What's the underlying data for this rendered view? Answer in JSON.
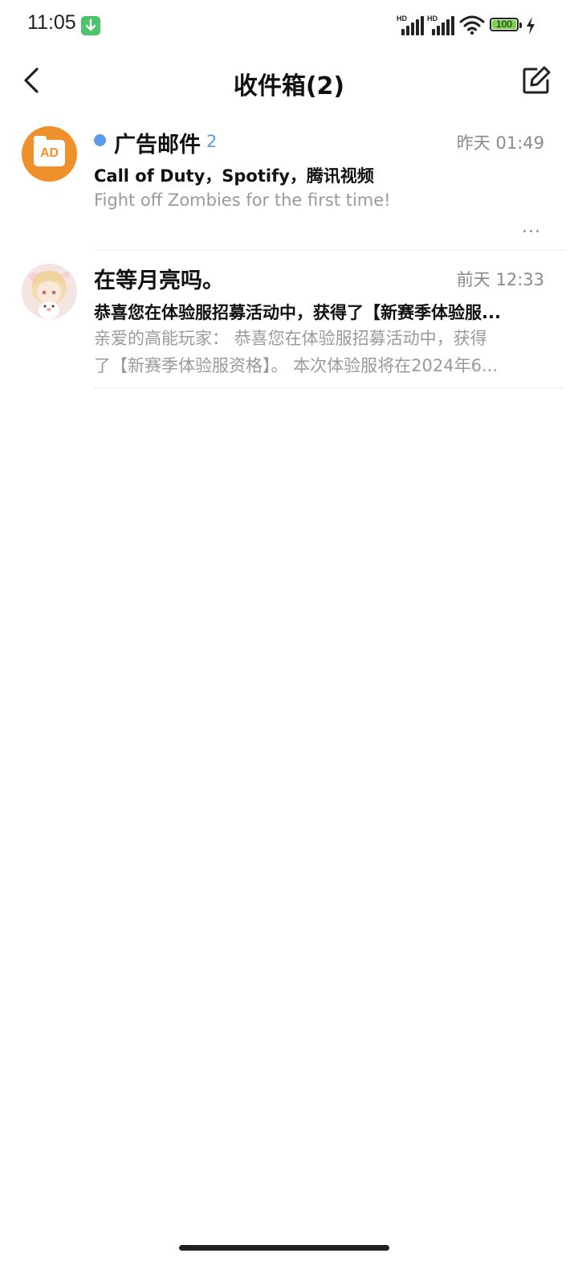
{
  "status_bar": {
    "time": "11:05",
    "battery": "100",
    "network_hd_1": "HD",
    "network_hd_2": "HD"
  },
  "header": {
    "title": "收件箱(2)"
  },
  "mails": [
    {
      "sender": "广告邮件",
      "count": "2",
      "time": "昨天 01:49",
      "subject": "Call of Duty，Spotify，腾讯视频",
      "preview": "Fight off Zombies for the first time!",
      "more": "...",
      "avatar_label": "AD",
      "unread": true
    },
    {
      "sender": "在等月亮吗。",
      "time": "前天 12:33",
      "subject": "恭喜您在体验服招募活动中，获得了【新赛季体验服...",
      "preview_line1": "亲爱的高能玩家：   恭喜您在体验服招募活动中，获得",
      "preview_line2": "了【新赛季体验服资格】。 本次体验服将在2024年6...",
      "unread": false
    }
  ],
  "colors": {
    "accent": "#5b9bea",
    "ad_avatar": "#f0902a",
    "secondary_text": "#9a9a9a"
  }
}
